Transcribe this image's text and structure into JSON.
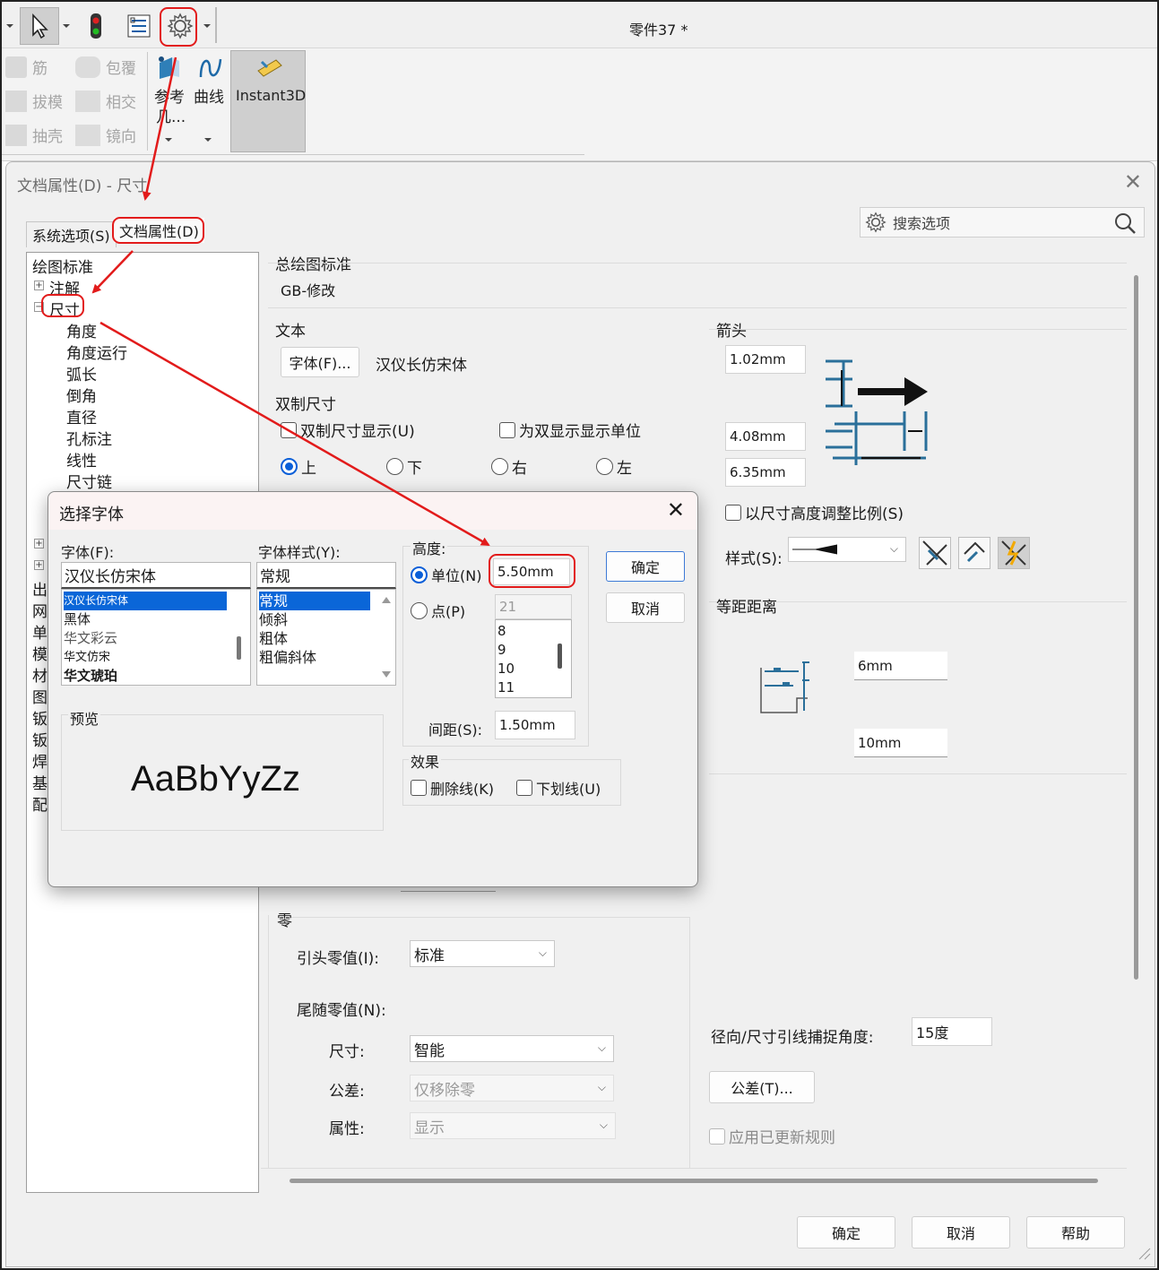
{
  "app": {
    "doc_title": "零件37 *"
  },
  "ribbon": {
    "items": [
      "筋",
      "包覆",
      "拔模",
      "相交",
      "抽壳",
      "镜向"
    ],
    "ref_label": "参考",
    "ref_label2": "几...",
    "curve_label": "曲线",
    "instant3d_label": "Instant3D"
  },
  "dialog": {
    "title": "文档属性(D) - 尺寸",
    "tab_system": "系统选项(S)",
    "tab_document": "文档属性(D)",
    "search_placeholder": "搜索选项"
  },
  "tree": {
    "root": "绘图标准",
    "annotations": "注解",
    "dimensions": "尺寸",
    "children": [
      "角度",
      "角度运行",
      "弧长",
      "倒角",
      "直径",
      "孔标注",
      "线性",
      "尺寸链"
    ],
    "truncated": [
      "出",
      "网",
      "单",
      "模",
      "材",
      "图",
      "钣",
      "钣",
      "焊",
      "基",
      "配"
    ]
  },
  "panel": {
    "overall_std_title": "总绘图标准",
    "overall_std_value": "GB-修改",
    "text_title": "文本",
    "font_button": "字体(F)...",
    "font_value": "汉仪长仿宋体",
    "dual_title": "双制尺寸",
    "dual_display": "双制尺寸显示(U)",
    "dual_units": "为双显示显示单位",
    "pos_top": "上",
    "pos_bottom": "下",
    "pos_right": "右",
    "pos_left": "左",
    "arrows_title": "箭头",
    "arrow_v1": "1.02mm",
    "arrow_v2": "4.08mm",
    "arrow_v3": "6.35mm",
    "scale_by_height": "以尺寸高度调整比例(S)",
    "style_label": "样式(S):",
    "offset_title": "等距距离",
    "offset_v1": "6mm",
    "offset_v2": "10mm",
    "zero_title": "零",
    "leading_zero_label": "引头零值(I):",
    "leading_zero_value": "标准",
    "trailing_zero_label": "尾随零值(N):",
    "dim_label": "尺寸:",
    "dim_value": "智能",
    "tol_label": "公差:",
    "tol_value": "仅移除零",
    "prop_label": "属性:",
    "prop_value": "显示",
    "radial_label": "径向/尺寸引线捕捉角度:",
    "radial_value": "15度",
    "tol_button": "公差(T)...",
    "apply_rules": "应用已更新规则"
  },
  "footer": {
    "ok": "确定",
    "cancel": "取消",
    "help": "帮助"
  },
  "font_dialog": {
    "title": "选择字体",
    "font_label": "字体(F):",
    "font_value": "汉仪长仿宋体",
    "font_list": [
      "汉仪长仿宋体",
      "黑体",
      "华文彩云",
      "华文仿宋",
      "华文琥珀"
    ],
    "style_label": "字体样式(Y):",
    "style_value": "常规",
    "style_list": [
      "常规",
      "倾斜",
      "粗体",
      "粗偏斜体"
    ],
    "height_label": "高度:",
    "unit_label": "单位(N)",
    "unit_value": "5.50mm",
    "point_label": "点(P)",
    "point_value": "21",
    "point_list": [
      "8",
      "9",
      "10",
      "11"
    ],
    "spacing_label": "间距(S):",
    "spacing_value": "1.50mm",
    "ok": "确定",
    "cancel": "取消",
    "preview_label": "预览",
    "preview_text": "AaBbYyZz",
    "effects_label": "效果",
    "strikeout": "删除线(K)",
    "underline": "下划线(U)"
  },
  "colors": {
    "annotation_red": "#e21b1b",
    "selection_blue": "#0a66d8",
    "icon_teal": "#2a6f9a"
  }
}
